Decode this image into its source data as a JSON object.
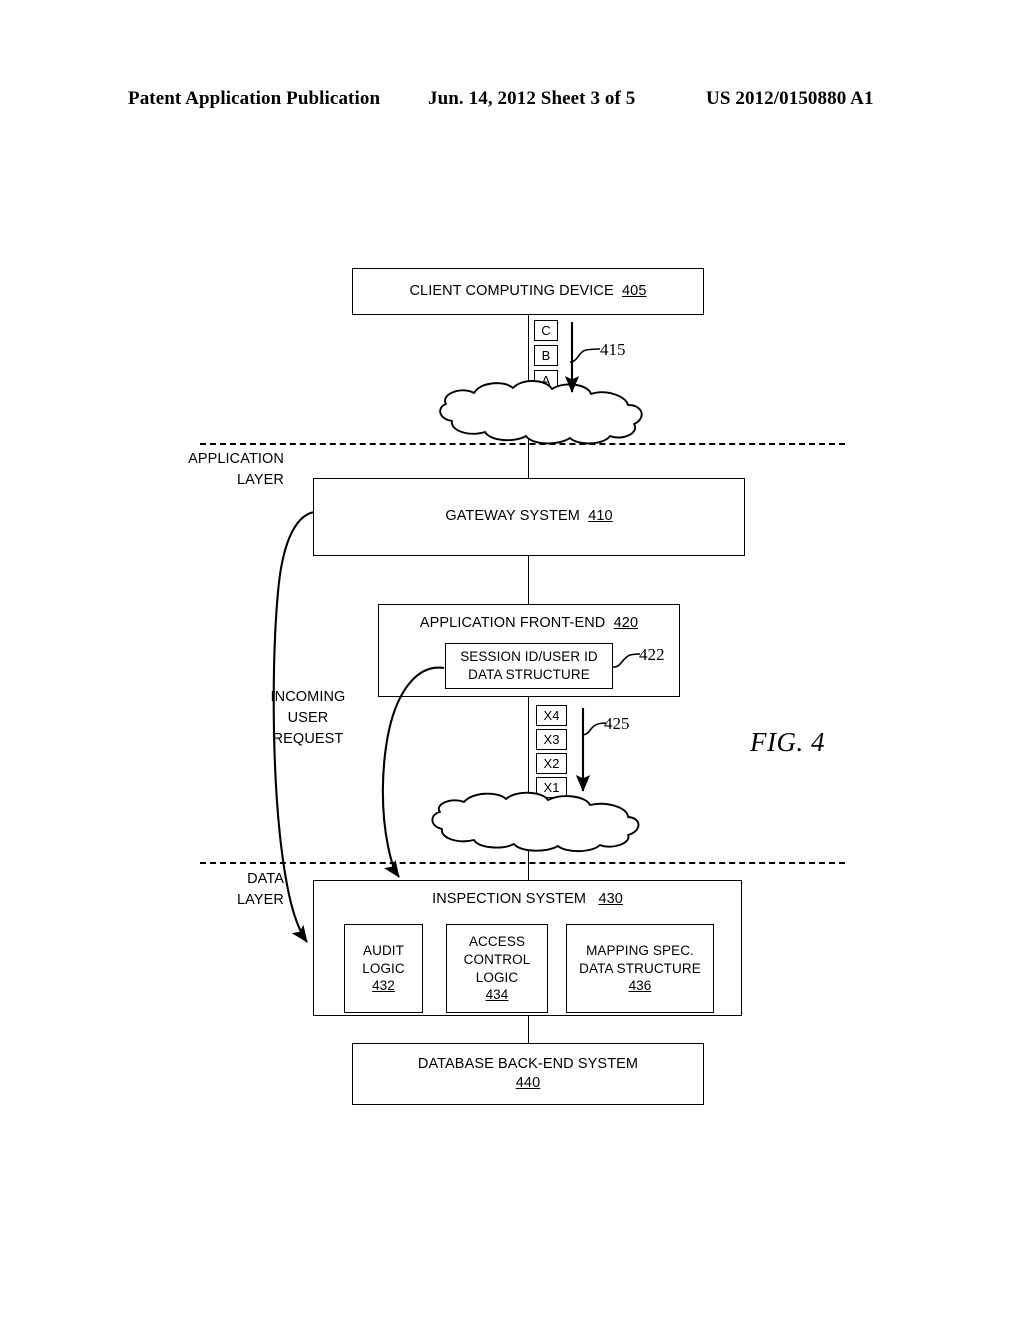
{
  "header": {
    "publication": "Patent Application Publication",
    "date_sheet": "Jun. 14, 2012  Sheet 3 of 5",
    "patent_number": "US 2012/0150880 A1"
  },
  "figure": {
    "caption": "FIG. 4"
  },
  "layers": {
    "application": "APPLICATION\nLAYER",
    "data": "DATA\nLAYER"
  },
  "annotations": {
    "incoming_request": "INCOMING\nUSER\nREQUEST",
    "ref_415": "415",
    "ref_422": "422",
    "ref_425": "425"
  },
  "blocks": {
    "client": {
      "label": "CLIENT COMPUTING DEVICE",
      "ref": "405"
    },
    "gateway": {
      "label": "GATEWAY SYSTEM",
      "ref": "410"
    },
    "app_frontend": {
      "label": "APPLICATION FRONT-END",
      "ref": "420"
    },
    "session_ds": {
      "line1": "SESSION ID/USER ID",
      "line2": "DATA STRUCTURE"
    },
    "inspection": {
      "label": "INSPECTION SYSTEM",
      "ref": "430"
    },
    "audit": {
      "line1": "AUDIT",
      "line2": "LOGIC",
      "ref": "432"
    },
    "access_control": {
      "line1": "ACCESS",
      "line2": "CONTROL",
      "line3": "LOGIC",
      "ref": "434"
    },
    "mapping": {
      "line1": "MAPPING SPEC.",
      "line2": "DATA STRUCTURE",
      "ref": "436"
    },
    "database": {
      "label": "DATABASE BACK-END SYSTEM",
      "ref": "440"
    }
  },
  "packets": {
    "upper": [
      "C",
      "B",
      "A"
    ],
    "lower": [
      "X4",
      "X3",
      "X2",
      "X1"
    ]
  },
  "colors": {
    "ink": "#000000",
    "paper": "#ffffff"
  }
}
